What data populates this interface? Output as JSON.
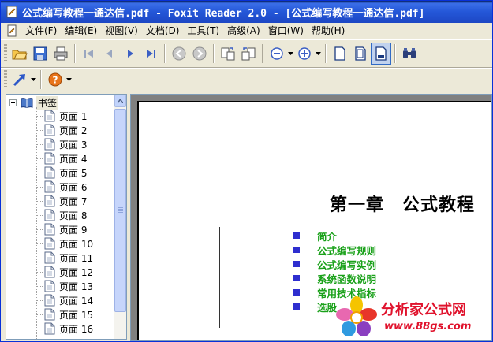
{
  "window": {
    "title": "公式编写教程一通达信.pdf - Foxit Reader 2.0 - [公式编写教程一通达信.pdf]"
  },
  "menu": {
    "items": [
      "文件(F)",
      "编辑(E)",
      "视图(V)",
      "文档(D)",
      "工具(T)",
      "高级(A)",
      "窗口(W)",
      "帮助(H)"
    ]
  },
  "toolbar": {
    "icons": [
      "open-icon",
      "save-icon",
      "print-icon",
      "first-page-icon",
      "prev-page-icon",
      "next-page-icon",
      "last-page-icon",
      "back-icon",
      "forward-icon",
      "rotate-icon",
      "rotate-counter-icon",
      "zoom-out-icon",
      "zoom-in-icon",
      "single-page-icon",
      "continuous-page-icon",
      "facing-page-icon",
      "binoculars-icon",
      "select-arrow-icon",
      "help-icon"
    ]
  },
  "bookmarks": {
    "root_label": "书签",
    "pages": [
      "页面 1",
      "页面 2",
      "页面 3",
      "页面 4",
      "页面 5",
      "页面 6",
      "页面 7",
      "页面 8",
      "页面 9",
      "页面 10",
      "页面 11",
      "页面 12",
      "页面 13",
      "页面 14",
      "页面 15",
      "页面 16"
    ]
  },
  "document": {
    "chapter_title": "第一章　公式教程",
    "toc": [
      "简介",
      "公式编写规则",
      "公式编写实例",
      "系统函数说明",
      "常用技术指标",
      "选股"
    ]
  },
  "watermark": {
    "line1": "分析家公式网",
    "line2": "www.88gs.com"
  },
  "colors": {
    "titlebar": "#2457d8",
    "toc_text": "#1aa11a",
    "toc_bullet": "#2e2ecf",
    "watermark": "#e0122c"
  }
}
